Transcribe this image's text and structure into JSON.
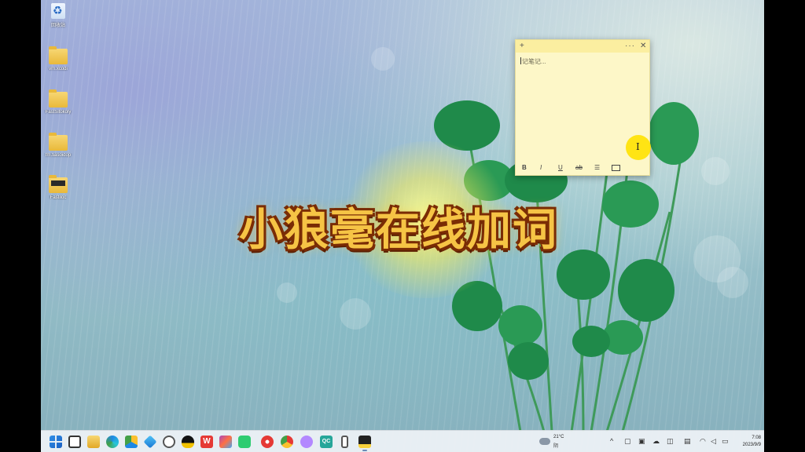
{
  "desktop_icons": [
    {
      "label": "回收站",
      "icon": "recycle-bin-icon"
    },
    {
      "label": "vm.xcodi",
      "icon": "folder-icon"
    },
    {
      "label": "FastSitokoly",
      "icon": "folder-icon"
    },
    {
      "label": "fm.tiasoidop",
      "icon": "folder-icon"
    },
    {
      "label": "Fastiloc",
      "icon": "folder-icon"
    }
  ],
  "banner_text": "小狼毫在线加词",
  "sticky_note": {
    "placeholder": "记笔记...",
    "add_symbol": "+",
    "more_symbol": "···",
    "close_symbol": "✕",
    "toolbar": {
      "bold": "B",
      "italic": "I",
      "underline": "U",
      "strike": "ab",
      "list": "☰"
    }
  },
  "cursor_glyph": "I",
  "taskbar": {
    "apps": [
      "start-button",
      "task-view-icon",
      "file-explorer-icon",
      "edge-browser-icon",
      "google-drive-icon",
      "kite-icon",
      "settings-gear-icon",
      "qq-penguin-icon",
      "wps-office-icon",
      "photos-icon",
      "wechat-icon",
      "huawei-icon",
      "chrome-icon",
      "app-icon",
      "qc-icon",
      "phone-icon",
      "notes-icon"
    ],
    "wps_label": "W",
    "qc_label": "QC",
    "weather": {
      "temp": "21°C",
      "condition": "阴"
    },
    "clock": {
      "time": "7:08",
      "date": "2023/9/9"
    }
  },
  "colors": {
    "taskbar": "#ebf0f5",
    "sticky": "#fdf7c8",
    "banner": "#f6c445"
  }
}
